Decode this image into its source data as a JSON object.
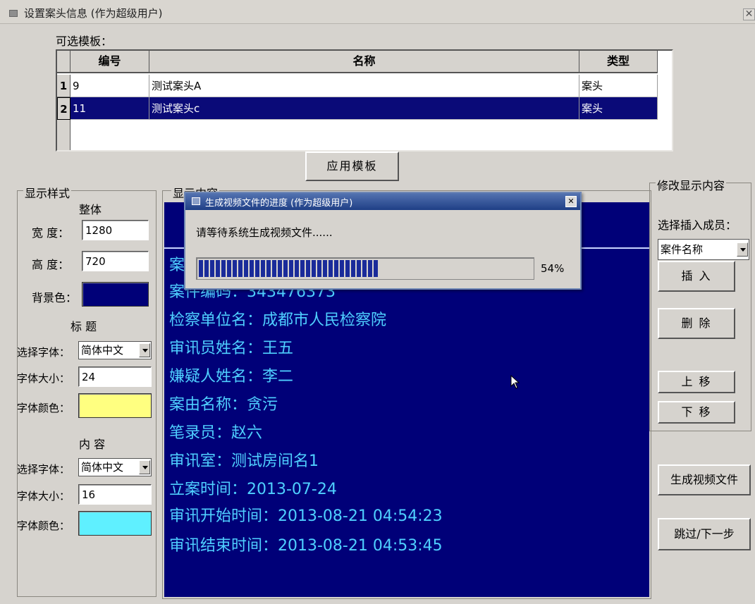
{
  "window": {
    "title": "设置案头信息 (作为超级用户)",
    "close_glyph": "✕"
  },
  "templates": {
    "label": "可选模板：",
    "columns": [
      "编号",
      "名称",
      "类型"
    ],
    "rows": [
      {
        "num": "1",
        "id": "9",
        "name": "测试案头A",
        "type": "案头",
        "selected": false
      },
      {
        "num": "2",
        "id": "11",
        "name": "测试案头c",
        "type": "案头",
        "selected": true
      }
    ],
    "apply_button": "应用模板"
  },
  "style_panel": {
    "title": "显示样式",
    "overall_label": "整体",
    "width_label": "宽 度：",
    "width_value": "1280",
    "height_label": "高 度：",
    "height_value": "720",
    "bg_label": "背景色：",
    "bg_color": "#000078",
    "title_section": "标 题",
    "font_label": "选择字体：",
    "title_font": "简体中文",
    "size_label": "字体大小：",
    "title_size": "24",
    "color_label": "字体颜色：",
    "title_color": "#ffff80",
    "content_section": "内 容",
    "content_font": "简体中文",
    "content_size": "16",
    "content_color": "#5ff0ff"
  },
  "content_panel": {
    "title": "显示内容",
    "lines": [
      "检察单位名：成都市人民检察院",
      "审讯员姓名：王五",
      "嫌疑人姓名：李二",
      "案由名称：贪污",
      "笔录员：赵六",
      "审讯室：测试房间名1",
      "立案时间：2013-07-24",
      "审讯开始时间：2013-08-21 04:54:23",
      "审讯结束时间：2013-08-21 04:53:45"
    ],
    "partial_line_1": "案",
    "partial_line_2": "案件编码：343476373"
  },
  "modify_panel": {
    "title": "修改显示内容",
    "member_label": "选择插入成员：",
    "member_value": "案件名称",
    "insert_button": "插 入",
    "delete_button": "删 除",
    "up_button": "上 移",
    "down_button": "下 移"
  },
  "actions": {
    "generate_button": "生成视频文件",
    "skip_button": "跳过/下一步"
  },
  "progress_dialog": {
    "title": "生成视频文件的进度 (作为超级用户)",
    "close_glyph": "✕",
    "message": "请等待系统生成视频文件......",
    "percent_text": "54%",
    "progress": 0.54
  }
}
